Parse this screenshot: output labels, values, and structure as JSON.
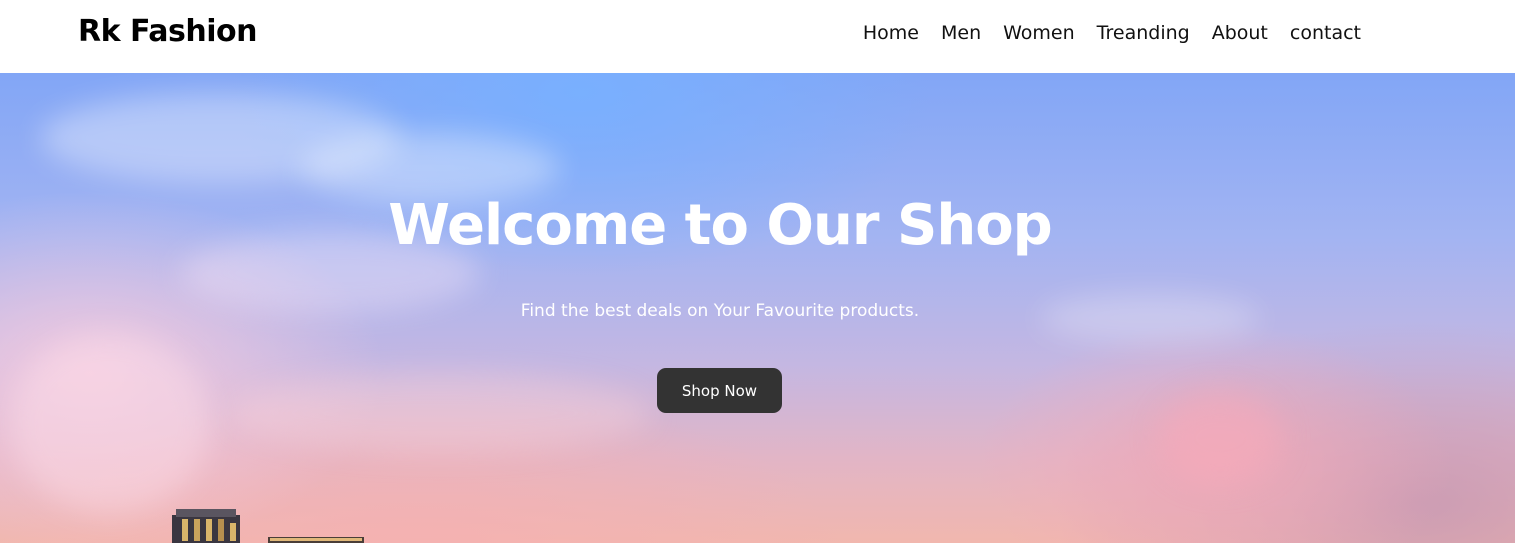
{
  "header": {
    "brand": "Rk Fashion",
    "nav": [
      {
        "label": "Home"
      },
      {
        "label": "Men"
      },
      {
        "label": "Women"
      },
      {
        "label": "Treanding"
      },
      {
        "label": "About"
      },
      {
        "label": "contact"
      }
    ]
  },
  "hero": {
    "title": "Welcome to Our Shop",
    "subtitle": "Find the best deals on Your Favourite products.",
    "cta_label": "Shop Now",
    "background_image": "sunset-sky-city-skyline"
  },
  "colors": {
    "nav_background": "#ffffff",
    "text_dark": "#000000",
    "hero_text": "#ffffff",
    "button_background": "#333333",
    "button_text": "#ffffff",
    "sky_top": "#82a6f6",
    "sky_bottom": "#f1b7ae"
  }
}
